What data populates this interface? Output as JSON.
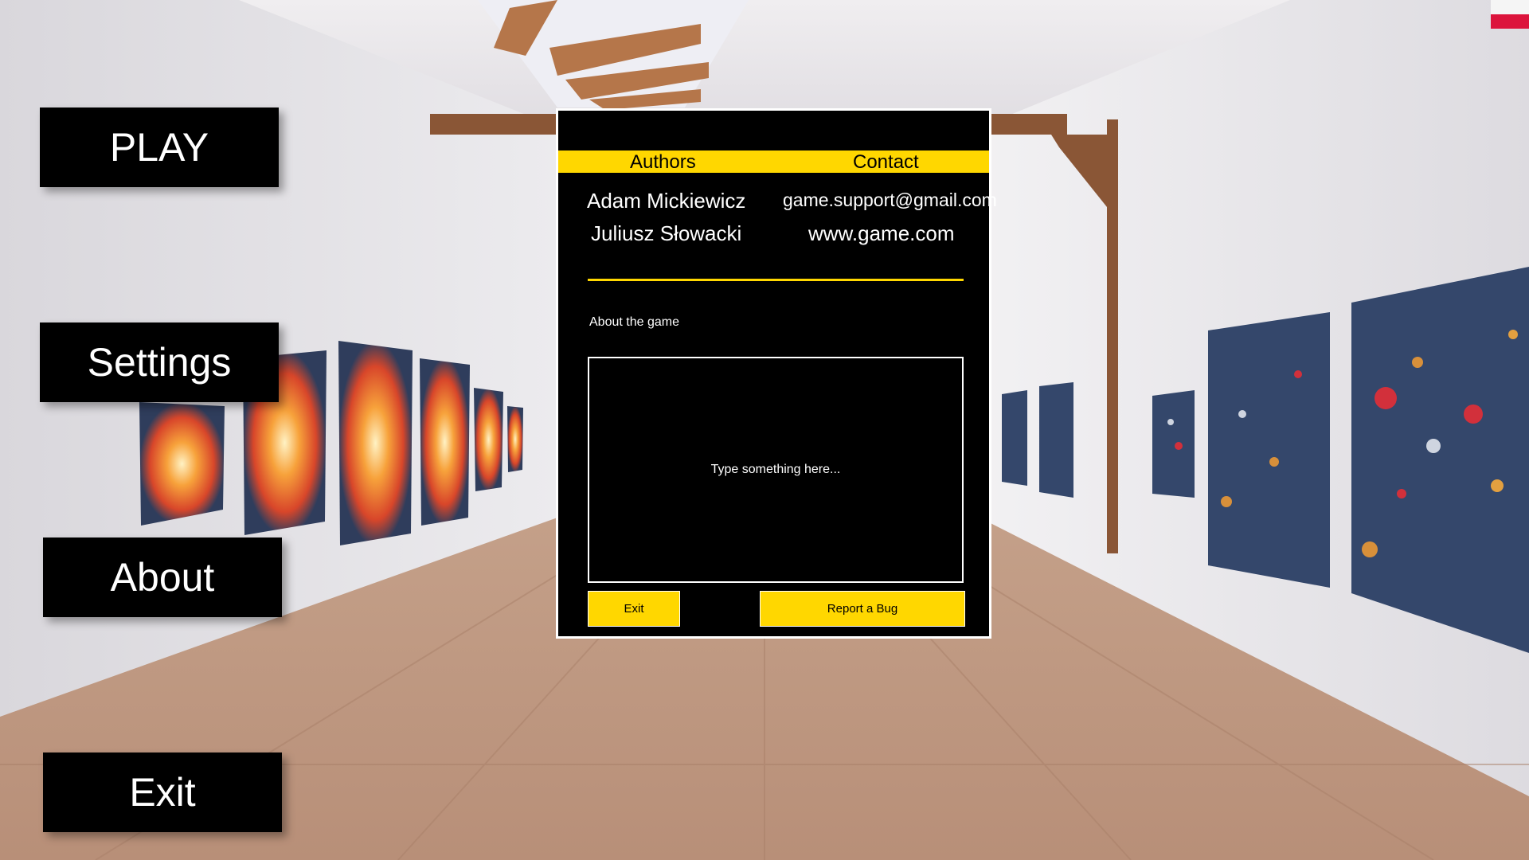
{
  "menu": {
    "play_label": "PLAY",
    "settings_label": "Settings",
    "about_label": "About",
    "exit_label": "Exit"
  },
  "language_flag": {
    "icon": "poland-flag-icon",
    "colors": [
      "#f5f5f5",
      "#dc143c"
    ]
  },
  "about_panel": {
    "header": {
      "authors_label": "Authors",
      "contact_label": "Contact"
    },
    "authors": [
      "Adam Mickiewicz",
      "Juliusz Słowacki"
    ],
    "contacts": [
      "game.support@gmail.com",
      "www.game.com"
    ],
    "about_label": "About the game",
    "textarea": {
      "value": "",
      "placeholder": "Type something here..."
    },
    "exit_button_label": "Exit",
    "report_button_label": "Report a Bug"
  },
  "colors": {
    "accent": "#ffd700",
    "panel_background": "#000000",
    "button_background": "#000000",
    "text": "#ffffff"
  }
}
